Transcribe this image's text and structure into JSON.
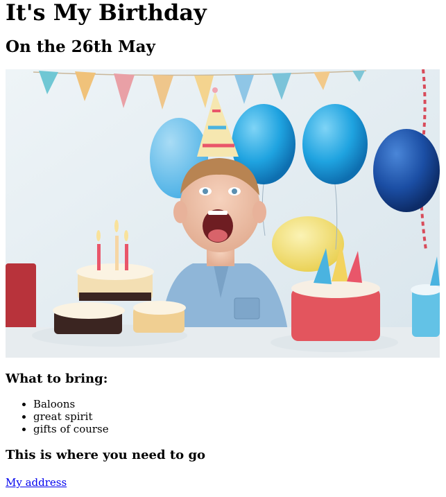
{
  "page": {
    "title": "It's My Birthday",
    "subtitle": "On the 26th May"
  },
  "hero": {
    "icon": "party-photo-icon",
    "colors": {
      "wall": "#dfe9ef",
      "balloon_blue": "#22a7e3",
      "balloon_navy": "#1b4ea4",
      "balloon_yellow": "#f3e27a",
      "cake_red": "#e3555e",
      "shirt": "#8fb6d8"
    }
  },
  "bring": {
    "heading": "What to bring:",
    "items": [
      "Baloons",
      "great spirit",
      "gifts of course"
    ]
  },
  "directions": {
    "heading": "This is where you need to go",
    "link_label": "My address"
  }
}
